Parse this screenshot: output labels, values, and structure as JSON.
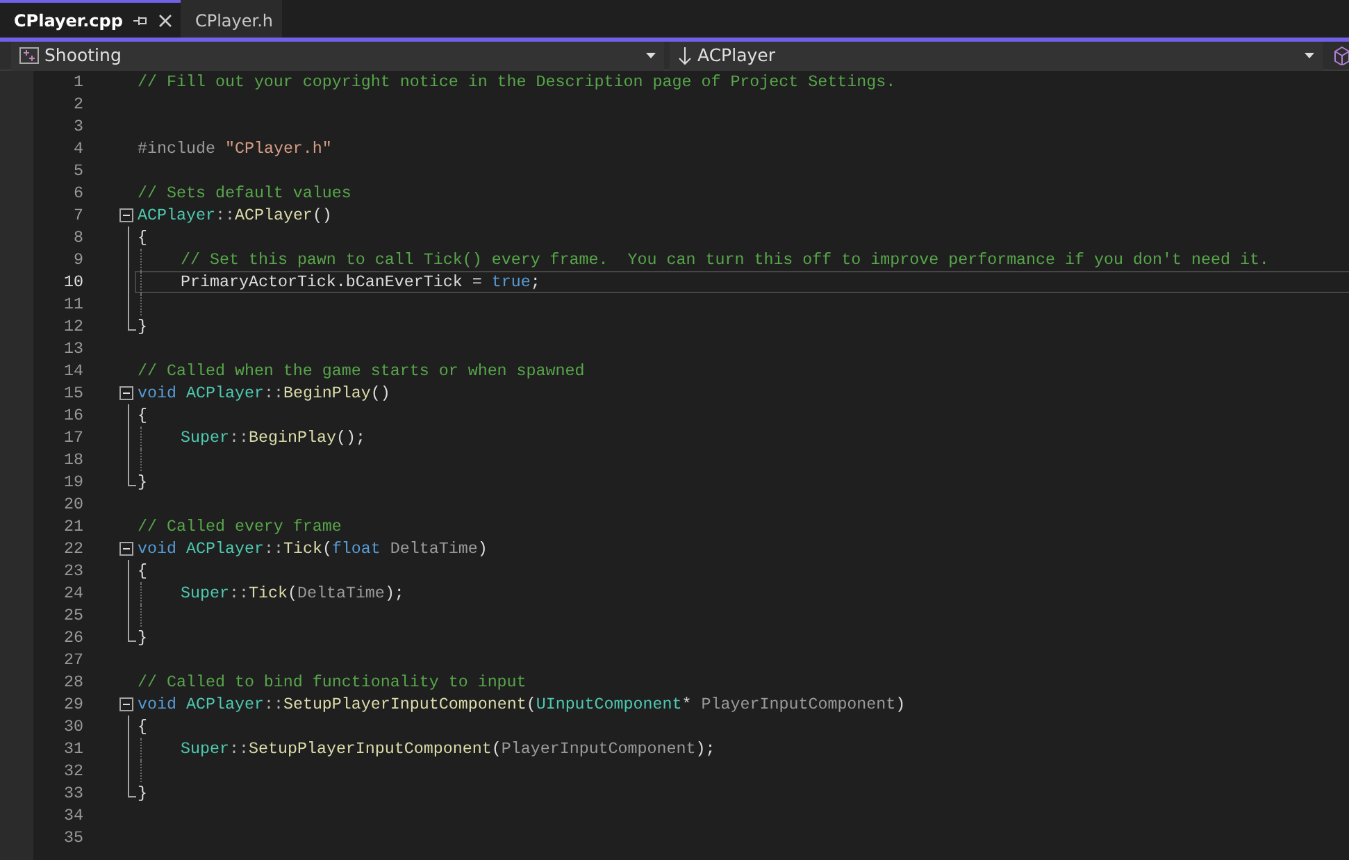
{
  "tabs": [
    {
      "label": "CPlayer.cpp",
      "selected": true,
      "pinned": true
    },
    {
      "label": "CPlayer.h",
      "selected": false,
      "pinned": false
    }
  ],
  "navigation": {
    "project": "Shooting",
    "scope": "ACPlayer"
  },
  "editor": {
    "lines": [
      {
        "number": "1",
        "tokens": [
          {
            "kind": "comment",
            "text": "// Fill out your copyright notice in the Description page of Project Settings."
          }
        ]
      },
      {
        "number": "2"
      },
      {
        "number": "3"
      },
      {
        "number": "4",
        "tokens": [
          {
            "kind": "preprocessor",
            "text": "#include "
          },
          {
            "kind": "string",
            "text": "\"CPlayer.h\""
          }
        ]
      },
      {
        "number": "5"
      },
      {
        "number": "6",
        "tokens": [
          {
            "kind": "comment",
            "text": "// Sets default values"
          }
        ]
      },
      {
        "number": "7",
        "collapsible": true,
        "tokens": [
          {
            "kind": "type",
            "text": "ACPlayer"
          },
          {
            "kind": "punct",
            "text": "::"
          },
          {
            "kind": "function",
            "text": "ACPlayer"
          },
          {
            "kind": "plain",
            "text": "()"
          }
        ]
      },
      {
        "number": "8",
        "in_block": true,
        "tokens": [
          {
            "kind": "plain",
            "text": "{"
          }
        ]
      },
      {
        "number": "9",
        "in_block": true,
        "indented": true,
        "tokens": [
          {
            "kind": "comment",
            "text": "// Set this pawn to call Tick() every frame.  You can turn this off to improve performance if you don't need it."
          }
        ]
      },
      {
        "number": "10",
        "in_block": true,
        "indented": true,
        "current": true,
        "tokens": [
          {
            "kind": "plain",
            "text": "PrimaryActorTick.bCanEverTick = "
          },
          {
            "kind": "keyword",
            "text": "true"
          },
          {
            "kind": "plain",
            "text": ";"
          }
        ]
      },
      {
        "number": "11",
        "in_block": true,
        "indented": true
      },
      {
        "number": "12",
        "block_end": true,
        "tokens": [
          {
            "kind": "plain",
            "text": "}"
          }
        ]
      },
      {
        "number": "13"
      },
      {
        "number": "14",
        "tokens": [
          {
            "kind": "comment",
            "text": "// Called when the game starts or when spawned"
          }
        ]
      },
      {
        "number": "15",
        "collapsible": true,
        "tokens": [
          {
            "kind": "keyword",
            "text": "void "
          },
          {
            "kind": "type",
            "text": "ACPlayer"
          },
          {
            "kind": "punct",
            "text": "::"
          },
          {
            "kind": "function",
            "text": "BeginPlay"
          },
          {
            "kind": "plain",
            "text": "()"
          }
        ]
      },
      {
        "number": "16",
        "in_block": true,
        "tokens": [
          {
            "kind": "plain",
            "text": "{"
          }
        ]
      },
      {
        "number": "17",
        "in_block": true,
        "indented": true,
        "tokens": [
          {
            "kind": "type",
            "text": "Super"
          },
          {
            "kind": "punct",
            "text": "::"
          },
          {
            "kind": "function",
            "text": "BeginPlay"
          },
          {
            "kind": "plain",
            "text": "();"
          }
        ]
      },
      {
        "number": "18",
        "in_block": true,
        "indented": true
      },
      {
        "number": "19",
        "block_end": true,
        "tokens": [
          {
            "kind": "plain",
            "text": "}"
          }
        ]
      },
      {
        "number": "20"
      },
      {
        "number": "21",
        "tokens": [
          {
            "kind": "comment",
            "text": "// Called every frame"
          }
        ]
      },
      {
        "number": "22",
        "collapsible": true,
        "tokens": [
          {
            "kind": "keyword",
            "text": "void "
          },
          {
            "kind": "type",
            "text": "ACPlayer"
          },
          {
            "kind": "punct",
            "text": "::"
          },
          {
            "kind": "function",
            "text": "Tick"
          },
          {
            "kind": "plain",
            "text": "("
          },
          {
            "kind": "keyword",
            "text": "float"
          },
          {
            "kind": "param",
            "text": " DeltaTime"
          },
          {
            "kind": "plain",
            "text": ")"
          }
        ]
      },
      {
        "number": "23",
        "in_block": true,
        "tokens": [
          {
            "kind": "plain",
            "text": "{"
          }
        ]
      },
      {
        "number": "24",
        "in_block": true,
        "indented": true,
        "tokens": [
          {
            "kind": "type",
            "text": "Super"
          },
          {
            "kind": "punct",
            "text": "::"
          },
          {
            "kind": "function",
            "text": "Tick"
          },
          {
            "kind": "plain",
            "text": "("
          },
          {
            "kind": "param",
            "text": "DeltaTime"
          },
          {
            "kind": "plain",
            "text": ");"
          }
        ]
      },
      {
        "number": "25",
        "in_block": true,
        "indented": true
      },
      {
        "number": "26",
        "block_end": true,
        "tokens": [
          {
            "kind": "plain",
            "text": "}"
          }
        ]
      },
      {
        "number": "27"
      },
      {
        "number": "28",
        "tokens": [
          {
            "kind": "comment",
            "text": "// Called to bind functionality to input"
          }
        ]
      },
      {
        "number": "29",
        "collapsible": true,
        "tokens": [
          {
            "kind": "keyword",
            "text": "void "
          },
          {
            "kind": "type",
            "text": "ACPlayer"
          },
          {
            "kind": "punct",
            "text": "::"
          },
          {
            "kind": "function",
            "text": "SetupPlayerInputComponent"
          },
          {
            "kind": "plain",
            "text": "("
          },
          {
            "kind": "type",
            "text": "UInputComponent"
          },
          {
            "kind": "plain",
            "text": "*"
          },
          {
            "kind": "param",
            "text": " PlayerInputComponent"
          },
          {
            "kind": "plain",
            "text": ")"
          }
        ]
      },
      {
        "number": "30",
        "in_block": true,
        "tokens": [
          {
            "kind": "plain",
            "text": "{"
          }
        ]
      },
      {
        "number": "31",
        "in_block": true,
        "indented": true,
        "tokens": [
          {
            "kind": "type",
            "text": "Super"
          },
          {
            "kind": "punct",
            "text": "::"
          },
          {
            "kind": "function",
            "text": "SetupPlayerInputComponent"
          },
          {
            "kind": "plain",
            "text": "("
          },
          {
            "kind": "param",
            "text": "PlayerInputComponent"
          },
          {
            "kind": "plain",
            "text": ");"
          }
        ]
      },
      {
        "number": "32",
        "in_block": true,
        "indented": true
      },
      {
        "number": "33",
        "block_end": true,
        "tokens": [
          {
            "kind": "plain",
            "text": "}"
          }
        ]
      },
      {
        "number": "34"
      },
      {
        "number": "35"
      }
    ]
  }
}
